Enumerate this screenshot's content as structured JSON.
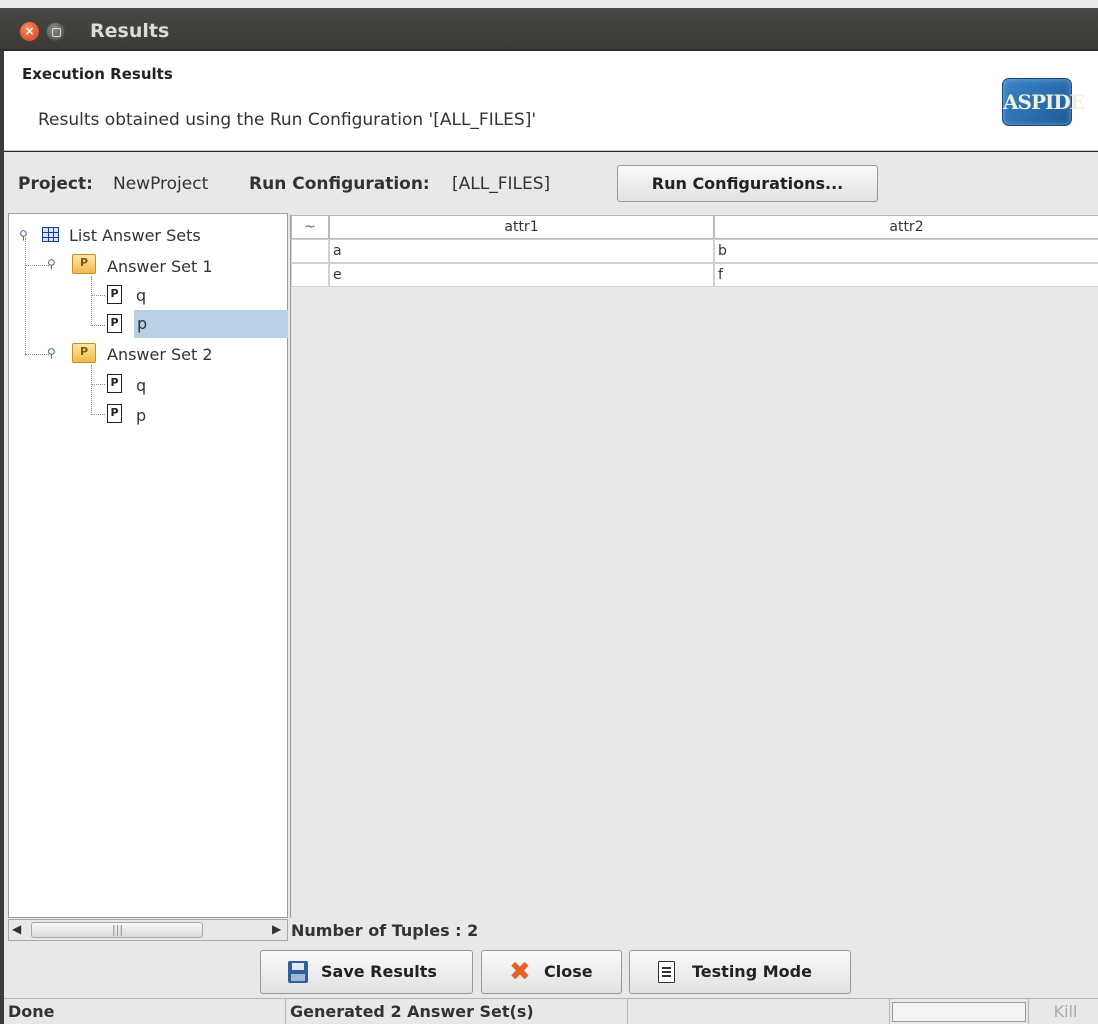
{
  "window": {
    "title": "Results"
  },
  "header": {
    "title": "Execution Results",
    "description": "Results obtained using the Run Configuration '[ALL_FILES]'",
    "logo_text": "ASPIDE"
  },
  "project": {
    "project_label": "Project:",
    "project_value": "NewProject",
    "runconf_label": "Run Configuration:",
    "runconf_value": "[ALL_FILES]",
    "run_configurations_button": "Run Configurations..."
  },
  "tree": {
    "root_label": "List Answer Sets",
    "answer_sets": [
      {
        "label": "Answer Set 1",
        "children": [
          "q",
          "p"
        ]
      },
      {
        "label": "Answer Set 2",
        "children": [
          "q",
          "p"
        ]
      }
    ],
    "selected": "Answer Set 1 / p"
  },
  "table": {
    "corner_header": "~",
    "columns": [
      "attr1",
      "attr2"
    ],
    "rows": [
      [
        "a",
        "b"
      ],
      [
        "e",
        "f"
      ]
    ],
    "tuples_label": "Number of Tuples : 2"
  },
  "buttons": {
    "save_results": "Save Results",
    "close": "Close",
    "testing_mode": "Testing Mode"
  },
  "status": {
    "left": "Done",
    "middle": "Generated 2 Answer Set(s)",
    "kill": "Kill"
  }
}
